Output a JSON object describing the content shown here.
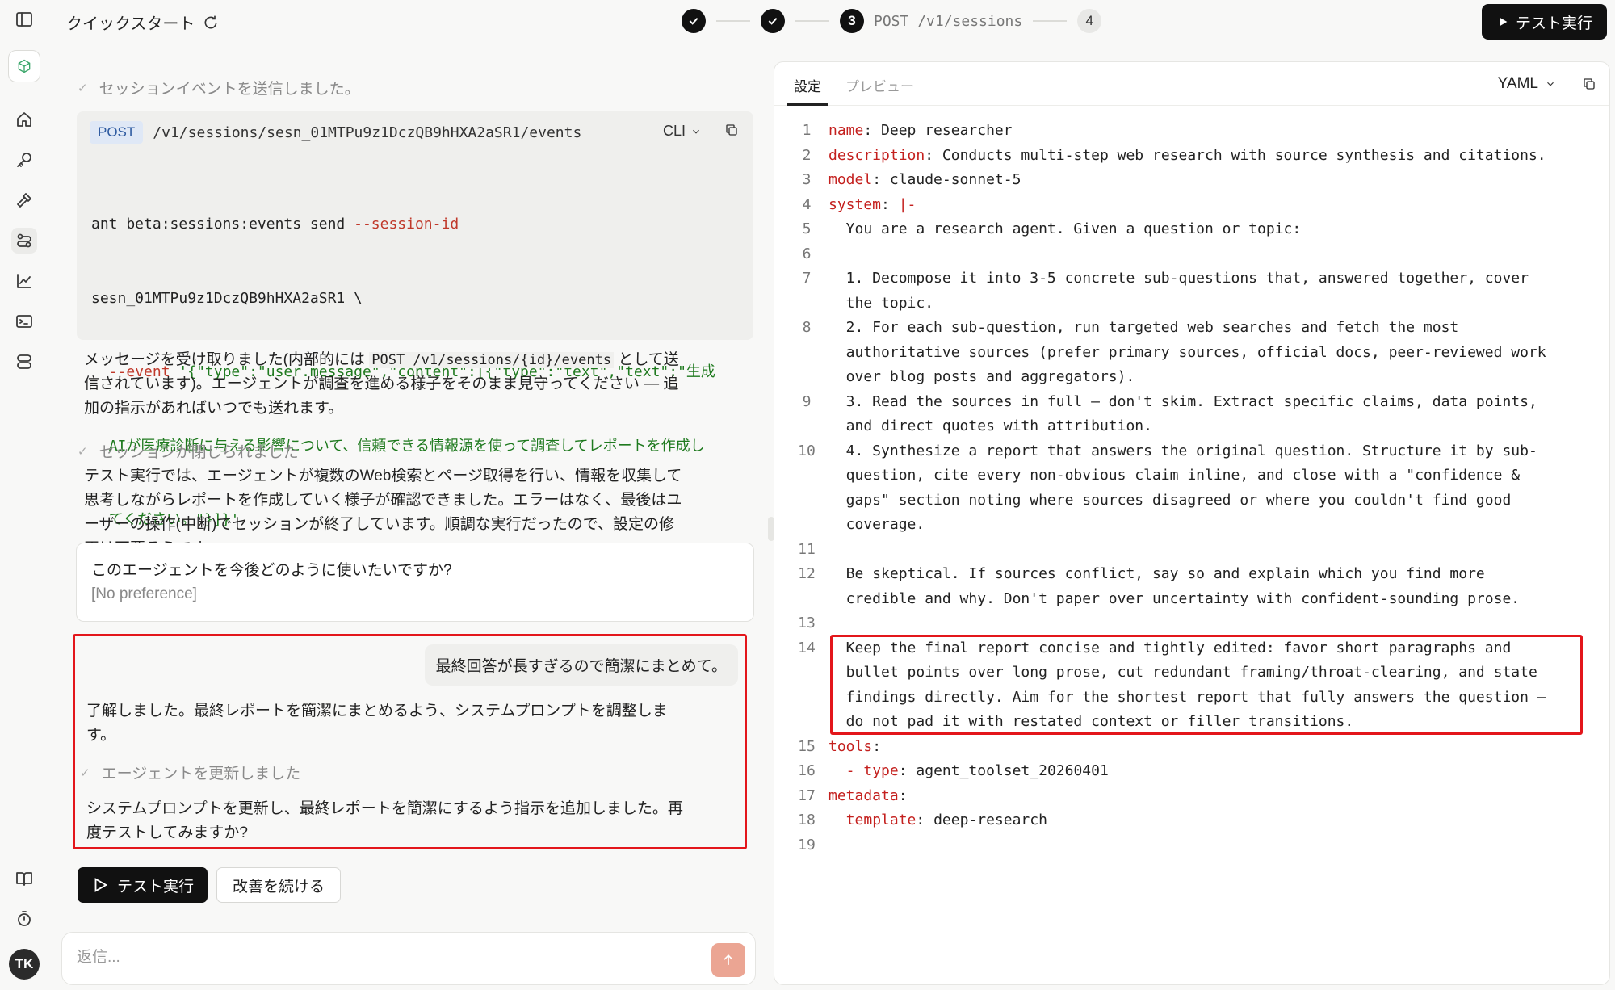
{
  "header": {
    "title": "クイックスタート",
    "steps": [
      {
        "label": "",
        "state": "done"
      },
      {
        "label": "",
        "state": "done"
      },
      {
        "num": "3",
        "label": "POST /v1/sessions",
        "state": "active"
      },
      {
        "num": "4",
        "label": "",
        "state": "pending"
      }
    ],
    "run_button": "テスト実行"
  },
  "rail": {
    "icons": [
      "sidebar-toggle-icon",
      "cube-logo-icon",
      "home-icon",
      "key-icon",
      "hammer-icon",
      "sessions-icon",
      "chart-icon",
      "terminal-icon",
      "database-icon",
      "book-icon",
      "timer-icon"
    ],
    "avatar": "TK"
  },
  "chat": {
    "event1": "セッションイベントを送信しました。",
    "code": {
      "method": "POST",
      "url": "/v1/sessions/sesn_01MTPu9z1DczQB9hHXA2aSR1/events",
      "lang": "CLI",
      "line1_cmd": "ant beta:sessions:events send ",
      "line1_flag": "--session-id",
      "line2": "sesn_01MTPu9z1DczQB9hHXA2aSR1 \\",
      "line3_flag": "  --event ",
      "line3_val": "'{\"type\":\"user.message\",\"content\":[{\"type\":\"text\",\"text\":\"生成",
      "line4_val": "  AIが医療診断に与える影響について、信頼できる情報源を使って調査してレポートを作成し",
      "line5_val": "  てください。\"}]}'"
    },
    "msg1_a": "メッセージを受け取りました(内部的には ",
    "msg1_code": "POST /v1/sessions/{id}/events",
    "msg1_b": " として送",
    "msg1_line2": "信されています)。エージェントが調査を進める様子をそのまま見守ってください — 追",
    "msg1_line3": "加の指示があればいつでも送れます。",
    "event2": "セッションが閉じられました",
    "msg2_lines": [
      "テスト実行では、エージェントが複数のWeb検索とページ取得を行い、情報を収集して",
      "思考しながらレポートを作成していく様子が確認できました。エラーはなく、最後はユ",
      "ーザーの操作(中断)でセッションが終了しています。順調な実行だったので、設定の修",
      "正は不要そうです。"
    ],
    "question": "このエージェントを今後どのように使いたいですか?",
    "answer": "[No preference]",
    "user_message": "最終回答が長すぎるので簡潔にまとめて。",
    "reply1_lines": [
      "了解しました。最終レポートを簡潔にまとめるよう、システムプロンプトを調整しま",
      "す。"
    ],
    "event3": "エージェントを更新しました",
    "reply2_lines": [
      "システムプロンプトを更新し、最終レポートを簡潔にするよう指示を追加しました。再",
      "度テストしてみますか?"
    ],
    "btn_run": "テスト実行",
    "btn_continue": "改善を続ける",
    "reply_placeholder": "返信..."
  },
  "editor": {
    "tabs": [
      "設定",
      "プレビュー"
    ],
    "format": "YAML",
    "lines": [
      {
        "n": "1",
        "key": "name",
        "rest": ": Deep researcher"
      },
      {
        "n": "2",
        "key": "description",
        "rest": ": Conducts multi-step web research with source synthesis and citations."
      },
      {
        "n": "3",
        "key": "model",
        "rest": ": claude-sonnet-5"
      },
      {
        "n": "4",
        "key": "system",
        "rest": ": ",
        "extra": "|-"
      },
      {
        "n": "5",
        "text": "  You are a research agent. Given a question or topic:"
      },
      {
        "n": "6",
        "text": ""
      },
      {
        "n": "7",
        "text": "  1. Decompose it into 3-5 concrete sub-questions that, answered together, cover"
      },
      {
        "n": "",
        "text": "  the topic."
      },
      {
        "n": "8",
        "text": "  2. For each sub-question, run targeted web searches and fetch the most"
      },
      {
        "n": "",
        "text": "  authoritative sources (prefer primary sources, official docs, peer-reviewed work"
      },
      {
        "n": "",
        "text": "  over blog posts and aggregators)."
      },
      {
        "n": "9",
        "text": "  3. Read the sources in full — don't skim. Extract specific claims, data points,"
      },
      {
        "n": "",
        "text": "  and direct quotes with attribution."
      },
      {
        "n": "10",
        "text": "  4. Synthesize a report that answers the original question. Structure it by sub-"
      },
      {
        "n": "",
        "text": "  question, cite every non-obvious claim inline, and close with a \"confidence &"
      },
      {
        "n": "",
        "text": "  gaps\" section noting where sources disagreed or where you couldn't find good"
      },
      {
        "n": "",
        "text": "  coverage."
      },
      {
        "n": "11",
        "text": ""
      },
      {
        "n": "12",
        "text": "  Be skeptical. If sources conflict, say so and explain which you find more"
      },
      {
        "n": "",
        "text": "  credible and why. Don't paper over uncertainty with confident-sounding prose."
      },
      {
        "n": "13",
        "text": ""
      },
      {
        "n": "14",
        "text": "  Keep the final report concise and tightly edited: favor short paragraphs and"
      },
      {
        "n": "",
        "text": "  bullet points over long prose, cut redundant framing/throat-clearing, and state"
      },
      {
        "n": "",
        "text": "  findings directly. Aim for the shortest report that fully answers the question —"
      },
      {
        "n": "",
        "text": "  do not pad it with restated context or filler transitions."
      },
      {
        "n": "15",
        "key": "tools",
        "rest": ":"
      },
      {
        "n": "16",
        "pre": "  - ",
        "key": "type",
        "rest": ": agent_toolset_20260401"
      },
      {
        "n": "17",
        "key": "metadata",
        "rest": ":"
      },
      {
        "n": "18",
        "pre": "  ",
        "key": "template",
        "rest": ": deep-research"
      },
      {
        "n": "19",
        "text": ""
      }
    ]
  },
  "colors": {
    "accent": "#111111",
    "highlight": "#e3161b",
    "yaml_key": "#c4201e",
    "send": "#eba593"
  }
}
